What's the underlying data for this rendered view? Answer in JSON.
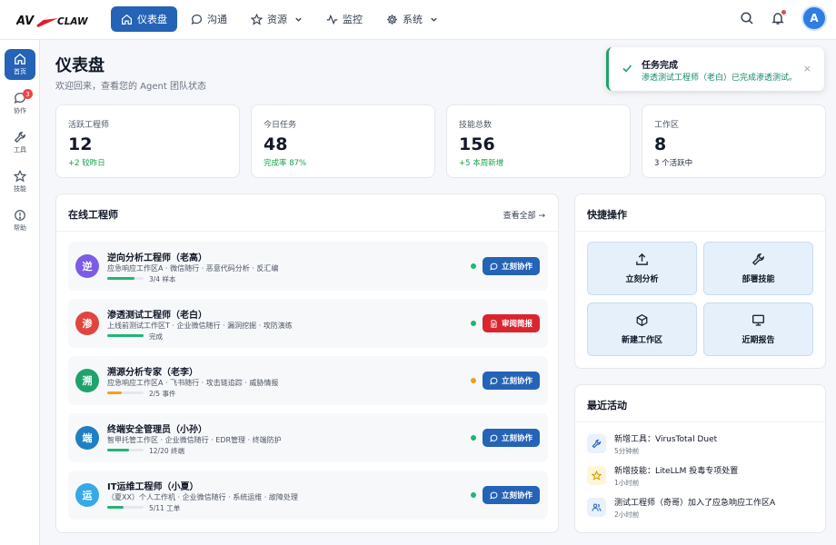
{
  "brand": {
    "logo_text": "AVCLAW"
  },
  "nav": [
    {
      "label": "仪表盘",
      "icon": "home-icon",
      "active": true
    },
    {
      "label": "沟通",
      "icon": "chat-icon"
    },
    {
      "label": "资源",
      "icon": "star-icon",
      "dropdown": true
    },
    {
      "label": "监控",
      "icon": "activity-icon"
    },
    {
      "label": "系统",
      "icon": "gear-icon",
      "dropdown": true
    }
  ],
  "user": {
    "avatar_letter": "A"
  },
  "sidebar": [
    {
      "label": "首页",
      "icon": "home-icon",
      "active": true
    },
    {
      "label": "协作",
      "icon": "chat-icon",
      "badge": "3"
    },
    {
      "label": "工具",
      "icon": "wrench-icon"
    },
    {
      "label": "技能",
      "icon": "star-icon"
    },
    {
      "label": "帮助",
      "icon": "help-icon"
    }
  ],
  "page": {
    "title": "仪表盘",
    "subtitle": "欢迎回来，查看您的 Agent 团队状态"
  },
  "toast": {
    "title": "任务完成",
    "message": "渗透测试工程师（老白）已完成渗透测试。",
    "close": "×"
  },
  "stats": [
    {
      "label": "活跃工程师",
      "value": "12",
      "note": "+2 较昨日",
      "note_style": "green"
    },
    {
      "label": "今日任务",
      "value": "48",
      "note": "完成率 87%",
      "note_style": "green"
    },
    {
      "label": "技能总数",
      "value": "156",
      "note": "+5 本周新增",
      "note_style": "green"
    },
    {
      "label": "工作区",
      "value": "8",
      "note": "3 个活跃中",
      "note_style": "dark"
    }
  ],
  "engineers_panel": {
    "title": "在线工程师",
    "view_all": "查看全部 →",
    "engineers": [
      {
        "avatar": "逆",
        "avatar_color": "#7c5ce6",
        "name": "逆向分析工程师（老高）",
        "desc": "应急响应工作区A · 微信随行 · 恶意代码分析 · 反汇编",
        "progress_text": "3/4 样本",
        "progress": 0.75,
        "bar_color": "#22b573",
        "status_color": "#22b573",
        "action": "立刻协作",
        "action_style": "blue"
      },
      {
        "avatar": "渗",
        "avatar_color": "#e0453f",
        "name": "渗透测试工程师（老白）",
        "desc": "上线前测试工作区T · 企业微信随行 · 漏洞挖掘 · 攻防演练",
        "progress_text": "完成",
        "progress": 1.0,
        "bar_color": "#22b573",
        "status_color": "#22b573",
        "action": "审阅简报",
        "action_style": "red"
      },
      {
        "avatar": "溯",
        "avatar_color": "#1fa36a",
        "name": "溯源分析专家（老李）",
        "desc": "应急响应工作区A · 飞书随行 · 攻击链追踪 · 威胁情报",
        "progress_text": "2/5 事件",
        "progress": 0.4,
        "bar_color": "#f0a020",
        "status_color": "#f59e0b",
        "action": "立刻协作",
        "action_style": "blue"
      },
      {
        "avatar": "端",
        "avatar_color": "#1f7fc4",
        "name": "终端安全管理员（小孙）",
        "desc": "智甲托管工作区 · 企业微信随行 · EDR管理 · 终端防护",
        "progress_text": "12/20 终端",
        "progress": 0.6,
        "bar_color": "#22b573",
        "status_color": "#22b573",
        "action": "立刻协作",
        "action_style": "blue"
      },
      {
        "avatar": "运",
        "avatar_color": "#36a9e6",
        "name": "IT运维工程师（小夏）",
        "desc": "（夏XX）个人工作机 · 企业微信随行 · 系统运维 · 故障处理",
        "progress_text": "5/11 工单",
        "progress": 0.45,
        "bar_color": "#22b573",
        "status_color": "#22b573",
        "action": "立刻协作",
        "action_style": "blue"
      }
    ]
  },
  "quick_actions": {
    "title": "快捷操作",
    "items": [
      {
        "label": "立刻分析",
        "icon": "upload-icon"
      },
      {
        "label": "部署技能",
        "icon": "wrench-icon"
      },
      {
        "label": "新建工作区",
        "icon": "cube-icon"
      },
      {
        "label": "近期报告",
        "icon": "monitor-icon"
      }
    ]
  },
  "activity": {
    "title": "最近活动",
    "items": [
      {
        "text": "新增工具：VirusTotal Duet",
        "time": "5分钟前",
        "icon": "wrench-icon",
        "bg": "#e8f1fc",
        "fg": "#2563b6"
      },
      {
        "text": "新增技能：LiteLLM 投毒专项处置",
        "time": "1小时前",
        "icon": "star-icon",
        "bg": "#fdf5d8",
        "fg": "#d49a00"
      },
      {
        "text": "测试工程师（奇哥）加入了应急响应工作区A",
        "time": "2小时前",
        "icon": "users-icon",
        "bg": "#e8f1fc",
        "fg": "#2563b6"
      }
    ]
  }
}
